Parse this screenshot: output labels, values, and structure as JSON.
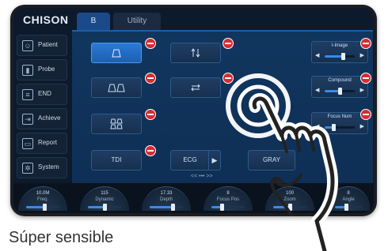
{
  "brand": "CHISON",
  "tabs": [
    "B",
    "Utility"
  ],
  "sidebar": [
    {
      "label": "Patient",
      "icon": "patient-icon"
    },
    {
      "label": "Probe",
      "icon": "probe-icon"
    },
    {
      "label": "END",
      "icon": "end-exam-icon"
    },
    {
      "label": "Achieve",
      "icon": "archive-icon"
    },
    {
      "label": "Report",
      "icon": "report-icon"
    },
    {
      "label": "System",
      "icon": "gear-icon"
    }
  ],
  "buttons": {
    "tdi": "TDI",
    "ecg": "ECG",
    "gray": "GRAY"
  },
  "sliders": [
    {
      "label": "I-Image",
      "level": 0.6
    },
    {
      "label": "Compound",
      "level": 0.5
    },
    {
      "label": "Focus Num",
      "level": 0.3
    }
  ],
  "pager": "<<    •••    >>",
  "knobs": [
    {
      "value": "10.0M",
      "name": "Freq.",
      "level": 0.55
    },
    {
      "value": "115",
      "name": "Dynamic",
      "level": 0.5
    },
    {
      "value": "17.33",
      "name": "Depth",
      "level": 0.7
    },
    {
      "value": "8",
      "name": "Focus Pos",
      "level": 0.3
    },
    {
      "value": "100",
      "name": "Zoom",
      "level": 0.5
    },
    {
      "value": "8",
      "name": "Angle",
      "level": 0.4
    }
  ],
  "caption": "Súper sensible",
  "colors": {
    "accent": "#2a7ad8",
    "delete": "#d62b32",
    "screen": "#0d1a2c"
  }
}
